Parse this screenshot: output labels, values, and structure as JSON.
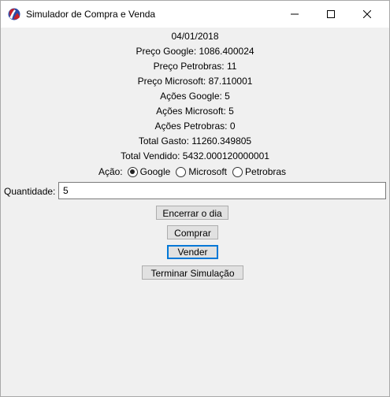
{
  "window": {
    "title": "Simulador de Compra e Venda"
  },
  "info": {
    "date": "04/01/2018",
    "preco_google": "Preço Google: 1086.400024",
    "preco_petrobras": "Preço Petrobras: 11",
    "preco_microsoft": "Preço Microsoft: 87.110001",
    "acoes_google": "Ações Google: 5",
    "acoes_microsoft": "Ações Microsoft: 5",
    "acoes_petrobras": "Ações Petrobras: 0",
    "total_gasto": "Total Gasto: 11260.349805",
    "total_vendido": "Total Vendido: 5432.000120000001"
  },
  "acao": {
    "label": "Ação:",
    "options": [
      "Google",
      "Microsoft",
      "Petrobras"
    ],
    "selected": "Google"
  },
  "quantidade": {
    "label": "Quantidade:",
    "value": "5"
  },
  "buttons": {
    "encerrar": "Encerrar o dia",
    "comprar": "Comprar",
    "vender": "Vender",
    "terminar": "Terminar Simulação"
  },
  "icons": {
    "app": "racket-logo-icon",
    "minimize": "minimize-icon",
    "maximize": "maximize-icon",
    "close": "close-icon"
  }
}
